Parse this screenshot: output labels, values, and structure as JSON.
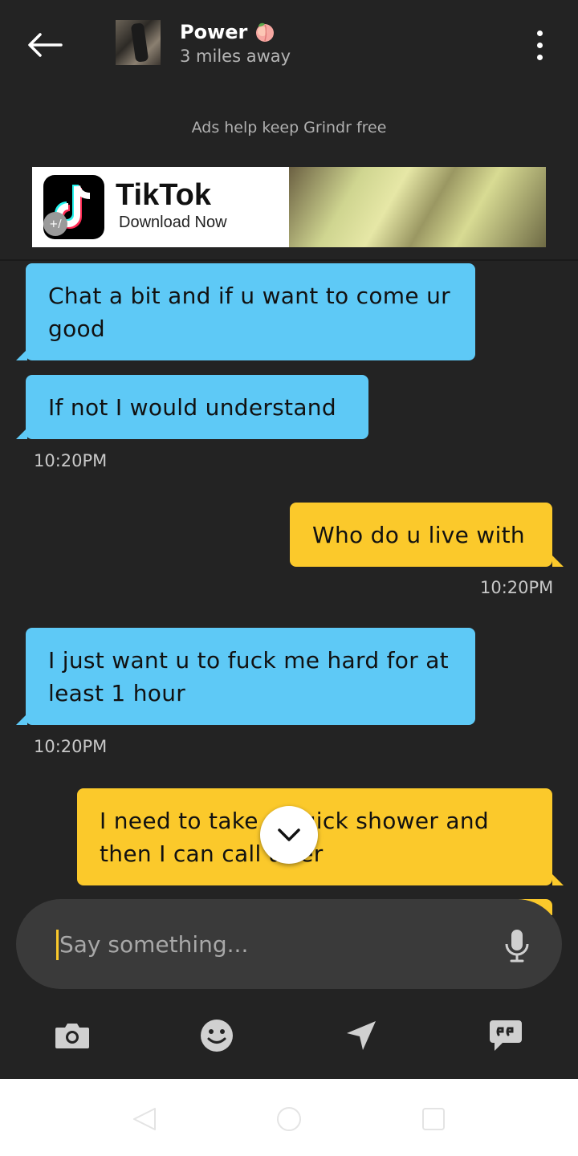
{
  "header": {
    "name": "Power",
    "distance": "3 miles away",
    "name_emoji_icon": "peach-icon"
  },
  "ad": {
    "note": "Ads help keep Grindr free",
    "brand": "TikTok",
    "cta": "Download Now"
  },
  "messages": [
    {
      "direction": "in",
      "text_lines": [
        "Chat a bit and if u want to come ur",
        "good"
      ]
    },
    {
      "direction": "in",
      "text_lines": [
        "If not I would understand"
      ],
      "time": "10:20PM"
    },
    {
      "direction": "out",
      "text_lines": [
        "Who do u live with"
      ],
      "time": "10:20PM"
    },
    {
      "direction": "in",
      "text_lines": [
        "I just want u to fuck me hard for at",
        "least 1 hour"
      ],
      "time": "10:20PM"
    },
    {
      "direction": "out",
      "text_lines": [
        "I need to take a quick shower and",
        "then I can call after"
      ]
    }
  ],
  "composer": {
    "placeholder": "Say something..."
  },
  "toolbar": [
    "camera-icon",
    "smiley-icon",
    "location-icon",
    "saved-phrases-icon"
  ],
  "colors": {
    "background": "#232323",
    "incoming_bubble": "#5ec9f6",
    "outgoing_bubble": "#fbc92b",
    "composer": "#3a3a3a"
  }
}
